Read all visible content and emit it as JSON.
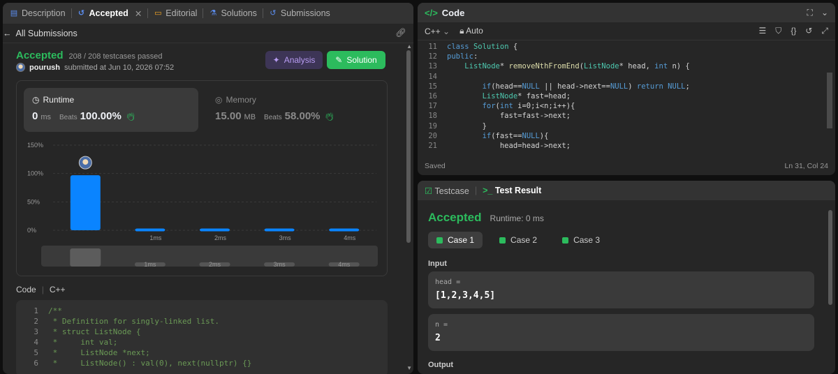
{
  "left_tabs": [
    {
      "label": "Description",
      "icon": "document-icon"
    },
    {
      "label": "Accepted",
      "icon": "history-icon",
      "active": true
    },
    {
      "label": "Editorial",
      "icon": "book-icon"
    },
    {
      "label": "Solutions",
      "icon": "flask-icon"
    },
    {
      "label": "Submissions",
      "icon": "history-icon"
    }
  ],
  "back_label": "All Submissions",
  "status": {
    "title": "Accepted",
    "passed": "208 / 208 testcases passed",
    "user": "pourush",
    "submitted_text": "submitted at Jun 10, 2026 07:52"
  },
  "buttons": {
    "analysis": "Analysis",
    "solution": "Solution"
  },
  "runtime": {
    "label": "Runtime",
    "value": "0",
    "unit": "ms",
    "beats_label": "Beats",
    "beats": "100.00%"
  },
  "memory": {
    "label": "Memory",
    "value": "15.00",
    "unit": "MB",
    "beats_label": "Beats",
    "beats": "58.00%"
  },
  "chart_data": {
    "type": "bar",
    "categories": [
      "0ms",
      "1ms",
      "2ms",
      "3ms",
      "4ms"
    ],
    "x_tick_labels": [
      "",
      "1ms",
      "2ms",
      "3ms",
      "4ms"
    ],
    "values": [
      97,
      3,
      3,
      3,
      3
    ],
    "ylim": [
      0,
      150
    ],
    "y_ticks": [
      "150%",
      "100%",
      "50%",
      "0%"
    ],
    "y_tick_values": [
      150,
      100,
      50,
      0
    ],
    "bar_color": "#0a84ff",
    "grid": true,
    "highlight_category": "0ms"
  },
  "code_section": {
    "label": "Code",
    "lang": "C++"
  },
  "code_preview": [
    {
      "n": "1",
      "t": "/**"
    },
    {
      "n": "2",
      "t": " * Definition for singly-linked list."
    },
    {
      "n": "3",
      "t": " * struct ListNode {"
    },
    {
      "n": "4",
      "t": " *     int val;"
    },
    {
      "n": "5",
      "t": " *     ListNode *next;"
    },
    {
      "n": "6",
      "t": " *     ListNode() : val(0), next(nullptr) {}"
    }
  ],
  "code_panel": {
    "title": "Code",
    "lang": "C++",
    "mode": "Auto",
    "saved": "Saved",
    "cursor": "Ln 31, Col 24"
  },
  "editor_lines": [
    {
      "n": "11",
      "t": "class Solution {"
    },
    {
      "n": "12",
      "t": "public:"
    },
    {
      "n": "13",
      "t": "    ListNode* removeNthFromEnd(ListNode* head, int n) {"
    },
    {
      "n": "14",
      "t": ""
    },
    {
      "n": "15",
      "t": "        if(head==NULL || head->next==NULL) return NULL;"
    },
    {
      "n": "16",
      "t": "        ListNode* fast=head;"
    },
    {
      "n": "17",
      "t": "        for(int i=0;i<n;i++){"
    },
    {
      "n": "18",
      "t": "            fast=fast->next;"
    },
    {
      "n": "19",
      "t": "        }"
    },
    {
      "n": "20",
      "t": "        if(fast==NULL){"
    },
    {
      "n": "21",
      "t": "            head=head->next;"
    }
  ],
  "result": {
    "tab_testcase": "Testcase",
    "tab_result": "Test Result",
    "status": "Accepted",
    "runtime": "Runtime: 0 ms",
    "cases": [
      "Case 1",
      "Case 2",
      "Case 3"
    ],
    "input_label": "Input",
    "output_label": "Output",
    "inputs": [
      {
        "name": "head =",
        "value": "[1,2,3,4,5]"
      },
      {
        "name": "n =",
        "value": "2"
      }
    ]
  },
  "colors": {
    "accent_green": "#2cbb5d",
    "bar_blue": "#0a84ff",
    "analysis_purple": "#b89cf2"
  }
}
